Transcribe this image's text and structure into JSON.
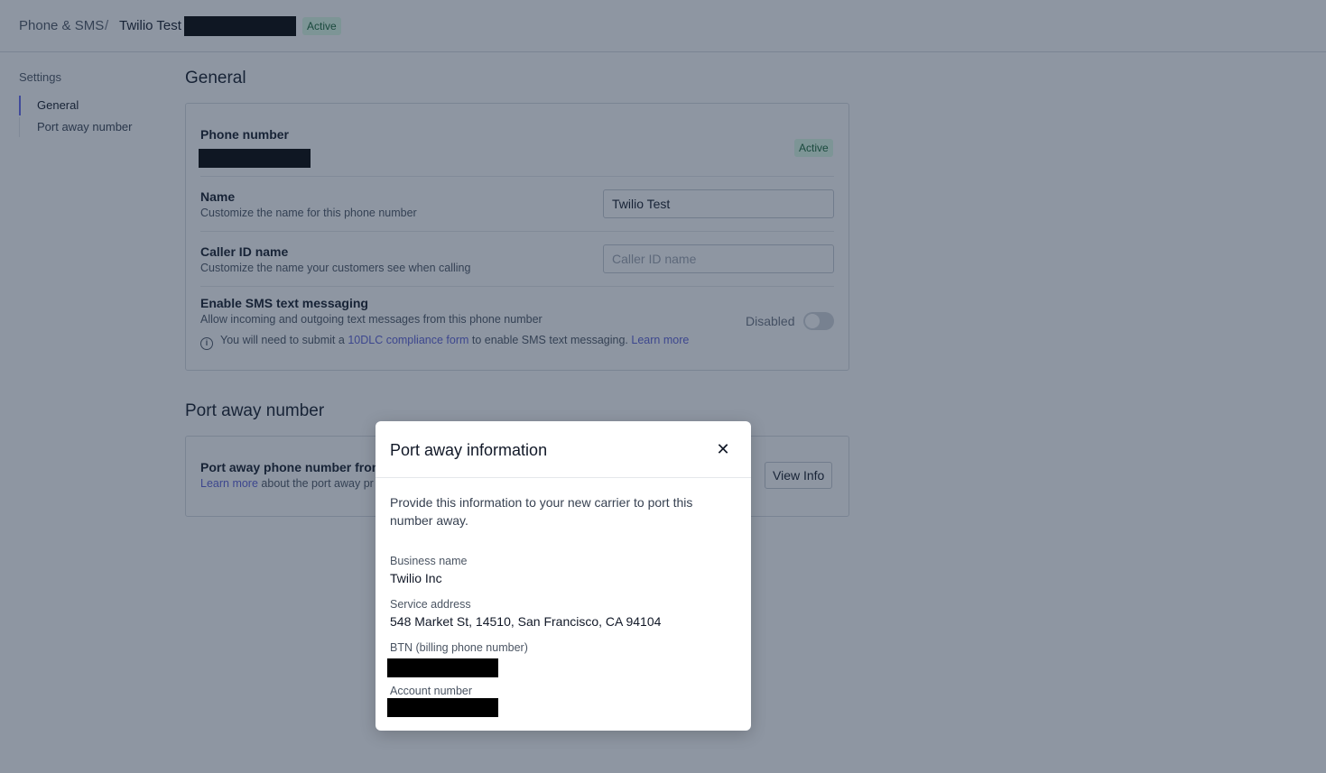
{
  "breadcrumb": {
    "root": "Phone & SMS",
    "separator": "/",
    "current": "Twilio Test",
    "status": "Active"
  },
  "sidenav": {
    "title": "Settings",
    "items": [
      {
        "label": "General",
        "active": true
      },
      {
        "label": "Port away number",
        "active": false
      }
    ]
  },
  "general": {
    "title": "General",
    "phone_number": {
      "label": "Phone number",
      "status": "Active"
    },
    "name": {
      "label": "Name",
      "description": "Customize the name for this phone number",
      "value": "Twilio Test"
    },
    "caller_id": {
      "label": "Caller ID name",
      "description": "Customize the name your customers see when calling",
      "placeholder": "Caller ID name"
    },
    "sms": {
      "label": "Enable SMS text messaging",
      "description": "Allow incoming and outgoing text messages from this phone number",
      "toggle_label": "Disabled",
      "enabled": false,
      "notice_prefix": "You will need to submit a",
      "notice_link": "10DLC compliance form",
      "notice_suffix": "to enable SMS text messaging.",
      "learn_more": "Learn more"
    }
  },
  "port_away": {
    "title": "Port away number",
    "row_label": "Port away phone number fron",
    "learn_more": "Learn more",
    "row_desc": "about the port away pr",
    "button": "View Info"
  },
  "modal": {
    "title": "Port away information",
    "close_glyph": "✕",
    "intro": "Provide this information to your new carrier to port this number away.",
    "fields": [
      {
        "label": "Business name",
        "value": "Twilio Inc"
      },
      {
        "label": "Service address",
        "value": "548 Market St, 14510, San Francisco, CA 94104"
      },
      {
        "label": "BTN (billing phone number)",
        "value": ""
      },
      {
        "label": "Account number",
        "value": ""
      }
    ]
  },
  "icons": {
    "info": "info-circle-icon",
    "close": "close-icon"
  }
}
